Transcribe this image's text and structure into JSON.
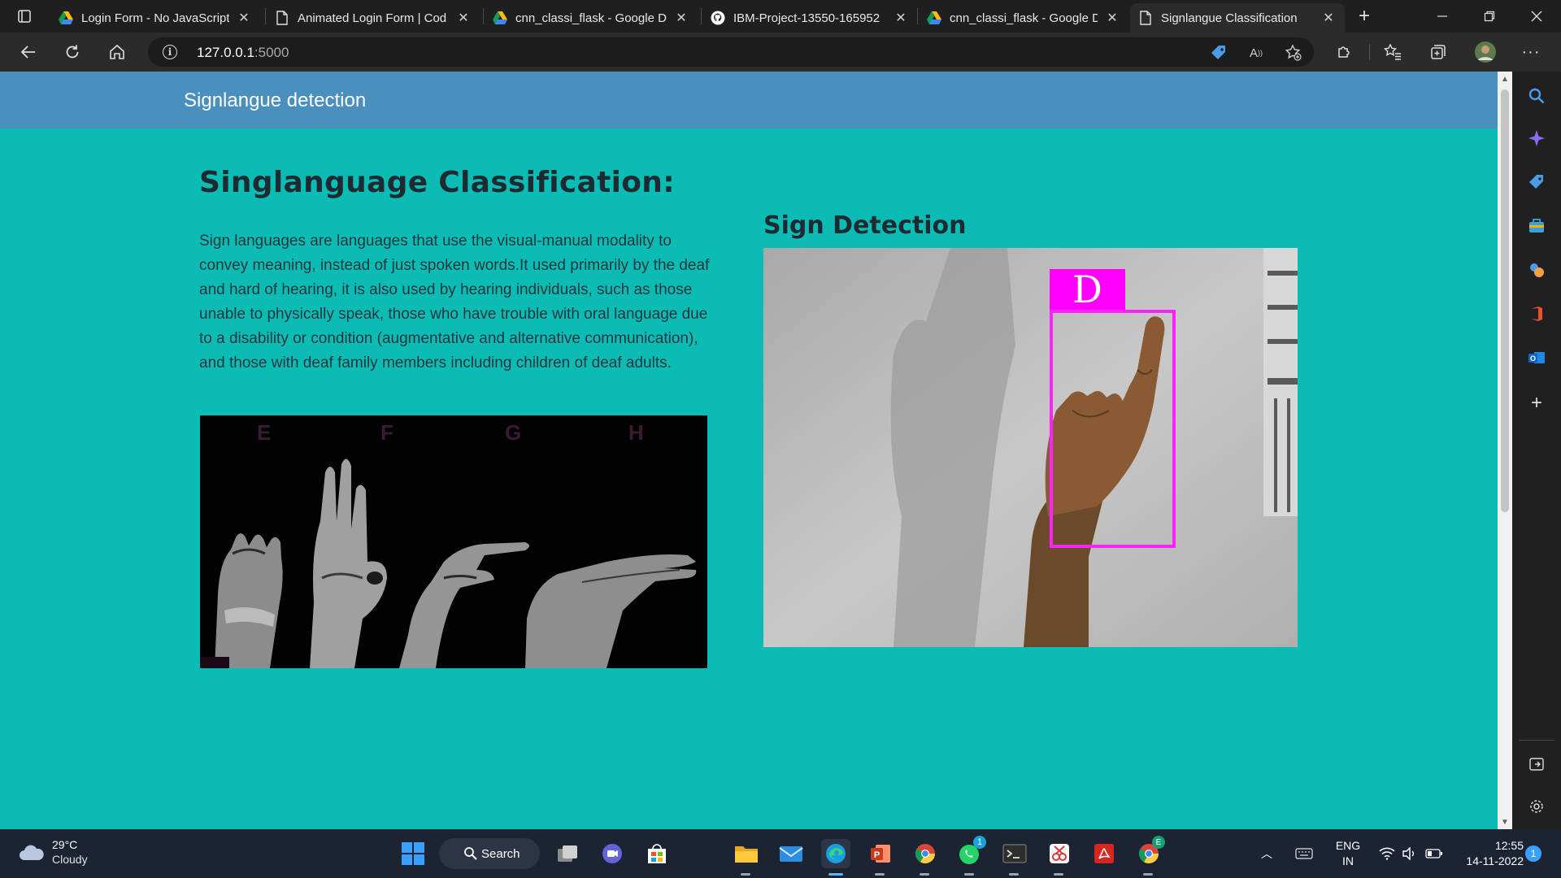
{
  "browser": {
    "tabs": [
      {
        "title": "Login Form - No JavaScript",
        "favicon": "google-drive-icon"
      },
      {
        "title": "Animated Login Form | Cod",
        "favicon": "page-icon"
      },
      {
        "title": "cnn_classi_flask - Google Dr",
        "favicon": "google-drive-icon"
      },
      {
        "title": "IBM-Project-13550-165952",
        "favicon": "github-icon"
      },
      {
        "title": "cnn_classi_flask - Google Dr",
        "favicon": "google-drive-icon"
      },
      {
        "title": "Signlangue Classification",
        "favicon": "page-icon",
        "active": true
      }
    ],
    "url_host": "127.0.0.1",
    "url_port": ":5000"
  },
  "page": {
    "brand": "Signlangue detection",
    "heading": "Singlanguage Classification:",
    "description": "Sign languages are languages that use the visual-manual modality to convey meaning, instead of just spoken words.It used primarily by the deaf and hard of hearing, it is also used by hearing individuals, such as those unable to physically speak, those who have trouble with oral language due to a disability or condition (augmentative and alternative communication), and those with deaf family members including children of deaf adults.",
    "asl_letters": [
      "E",
      "F",
      "G",
      "H"
    ],
    "sign_detection_title": "Sign Detection",
    "detected_label": "D",
    "accent_color": "#0bbcb5",
    "navbar_color": "#4a90bf",
    "bbox_color": "#ff00ff"
  },
  "taskbar": {
    "temperature": "29°C",
    "weather": "Cloudy",
    "search_label": "Search",
    "lang_top": "ENG",
    "lang_bottom": "IN",
    "time": "12:55",
    "date": "14-11-2022",
    "notification_count": "1",
    "whatsapp_badge": "1",
    "chrome_profile_badge": "E"
  }
}
